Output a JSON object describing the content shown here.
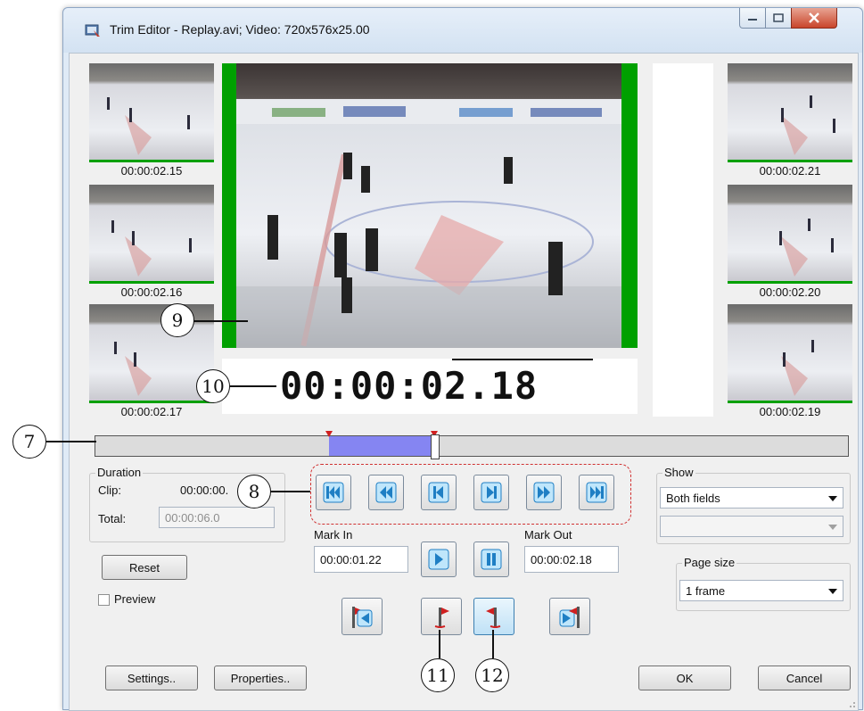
{
  "window": {
    "title": "Trim Editor - Replay.avi; Video: 720x576x25.00"
  },
  "thumbnails_left": [
    {
      "timecode": "00:00:02.15"
    },
    {
      "timecode": "00:00:02.16"
    },
    {
      "timecode": "00:00:02.17"
    }
  ],
  "thumbnails_right": [
    {
      "timecode": "00:00:02.21"
    },
    {
      "timecode": "00:00:02.20"
    },
    {
      "timecode": "00:00:02.19"
    }
  ],
  "current_timecode": "00:00:02.18",
  "timeline": {
    "mark_in_fraction": 0.31,
    "mark_out_fraction": 0.45,
    "playhead_fraction": 0.45
  },
  "duration": {
    "legend": "Duration",
    "clip_label": "Clip:",
    "clip_value": "00:00:00.",
    "total_label": "Total:",
    "total_value": "00:00:06.0"
  },
  "buttons": {
    "reset": "Reset",
    "preview_label": "Preview",
    "settings": "Settings..",
    "properties": "Properties..",
    "ok": "OK",
    "cancel": "Cancel"
  },
  "mark_in": {
    "label": "Mark In",
    "value": "00:00:01.22"
  },
  "mark_out": {
    "label": "Mark Out",
    "value": "00:00:02.18"
  },
  "show": {
    "legend": "Show",
    "selected": "Both fields",
    "secondary": ""
  },
  "page_size": {
    "legend": "Page size",
    "selected": "1 frame"
  },
  "callouts": {
    "c7": "7",
    "c8": "8",
    "c9": "9",
    "c10": "10",
    "c11": "11",
    "c12": "12"
  },
  "colors": {
    "timeline_selection": "#8585f2",
    "frame_border": "#00a000",
    "control_icon": "#2a8fd4",
    "flag": "#d02020"
  },
  "icons": {
    "go_start": "skip-to-start-icon",
    "prev_fast": "fast-backward-icon",
    "prev_frame": "step-backward-icon",
    "next_frame": "step-forward-icon",
    "next_fast": "fast-forward-icon",
    "go_end": "skip-to-end-icon",
    "play": "play-icon",
    "pause": "pause-icon",
    "go_mark_in": "go-to-mark-in-icon",
    "set_mark_in": "set-mark-in-flag-icon",
    "set_mark_out": "set-mark-out-flag-icon",
    "go_mark_out": "go-to-mark-out-icon"
  }
}
